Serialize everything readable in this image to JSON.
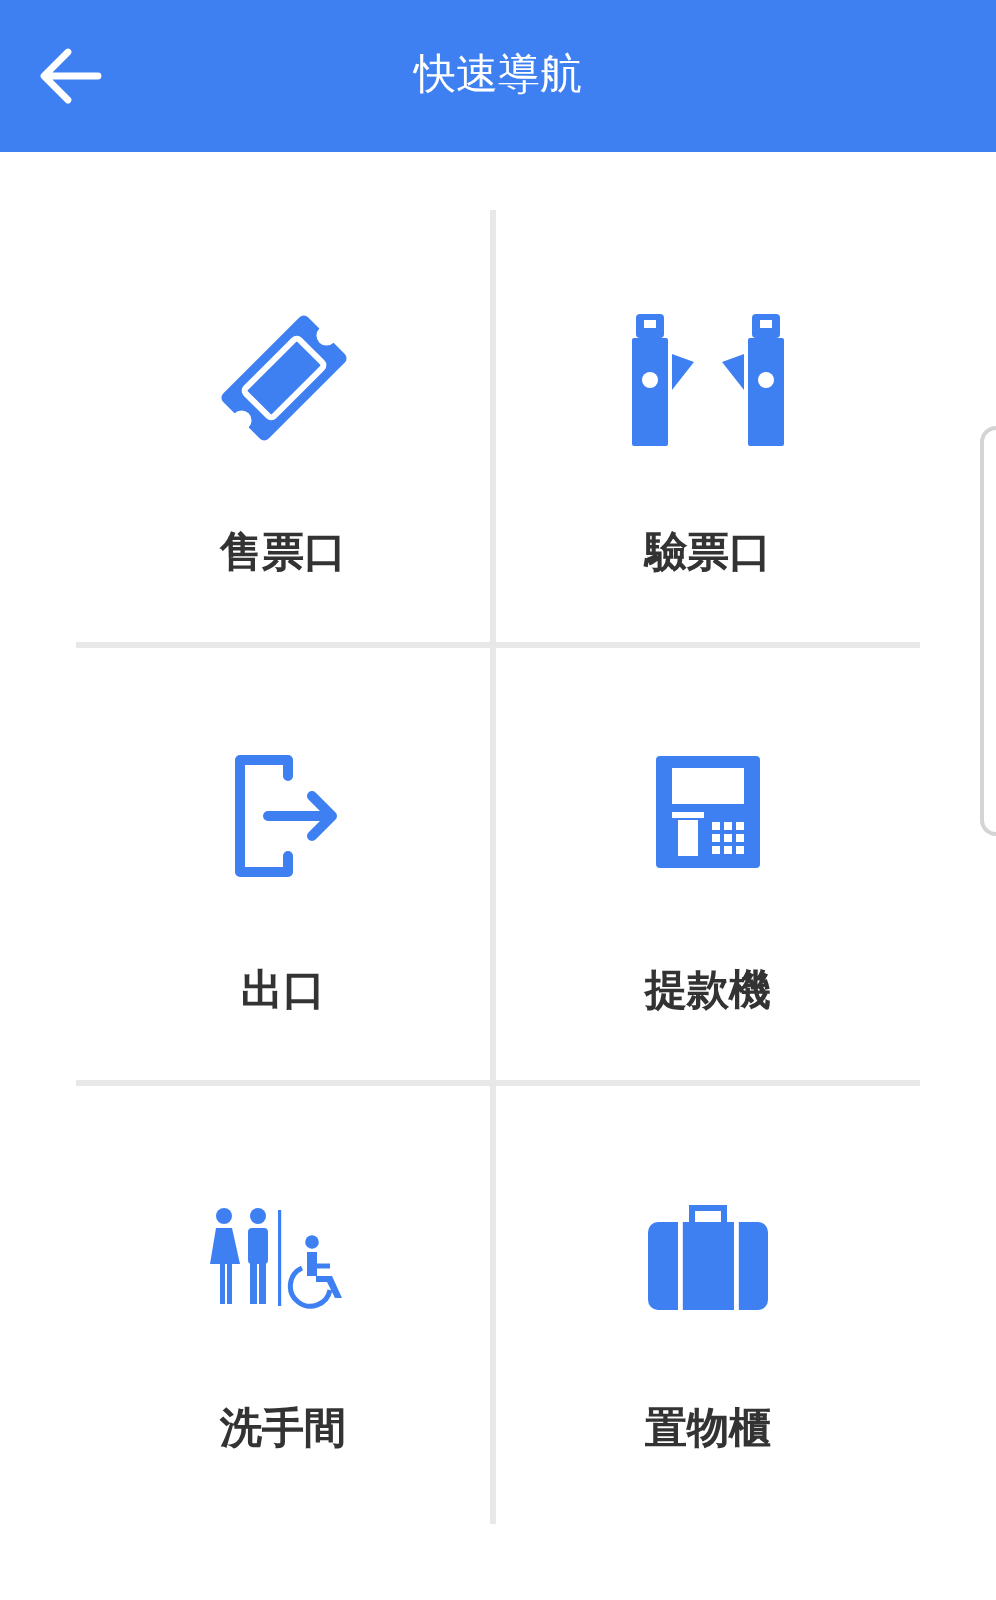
{
  "header": {
    "title": "快速導航"
  },
  "items": [
    {
      "label": "售票口",
      "kind": "ticket"
    },
    {
      "label": "驗票口",
      "kind": "gate"
    },
    {
      "label": "出口",
      "kind": "exit"
    },
    {
      "label": "提款機",
      "kind": "atm"
    },
    {
      "label": "洗手間",
      "kind": "restroom"
    },
    {
      "label": "置物櫃",
      "kind": "locker"
    }
  ]
}
